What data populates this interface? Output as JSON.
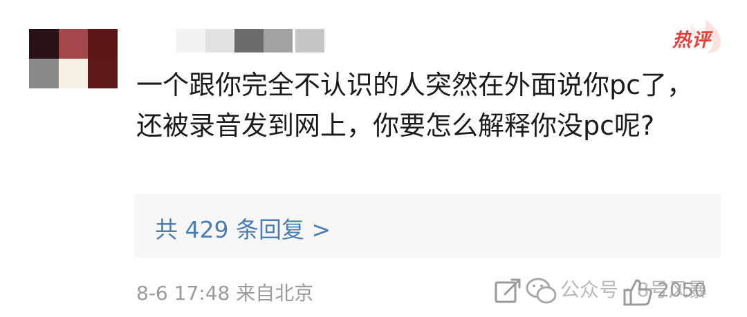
{
  "comment": {
    "badge": "热评",
    "text": "一个跟你完全不认识的人突然在外面说你pc了，还被录音发到网上，你要怎么解释你没pc呢?",
    "replies_label": "共 429 条回复 >",
    "time_location": "8-6 17:48  来自北京",
    "watermark": "公众号 · 8号风暴",
    "like_count": "2050"
  },
  "colors": {
    "avatar_pixels": [
      "#2a1017",
      "#a4484c",
      "#5a1617",
      "#8a8a8a",
      "#f7f1e4",
      "#5c1a1a"
    ],
    "nickname_pixels": [
      "#f3f3f3",
      "#e2e2e2",
      "#6c6c6c",
      "#a2a2a2",
      "#ededed",
      "#c6c6c6"
    ],
    "badge": "#e5403a",
    "link": "#4b7db1",
    "meta": "#9a9a9a"
  },
  "icons": {
    "share": "share-icon",
    "wechat": "wechat-icon",
    "like": "thumbs-up-icon"
  }
}
